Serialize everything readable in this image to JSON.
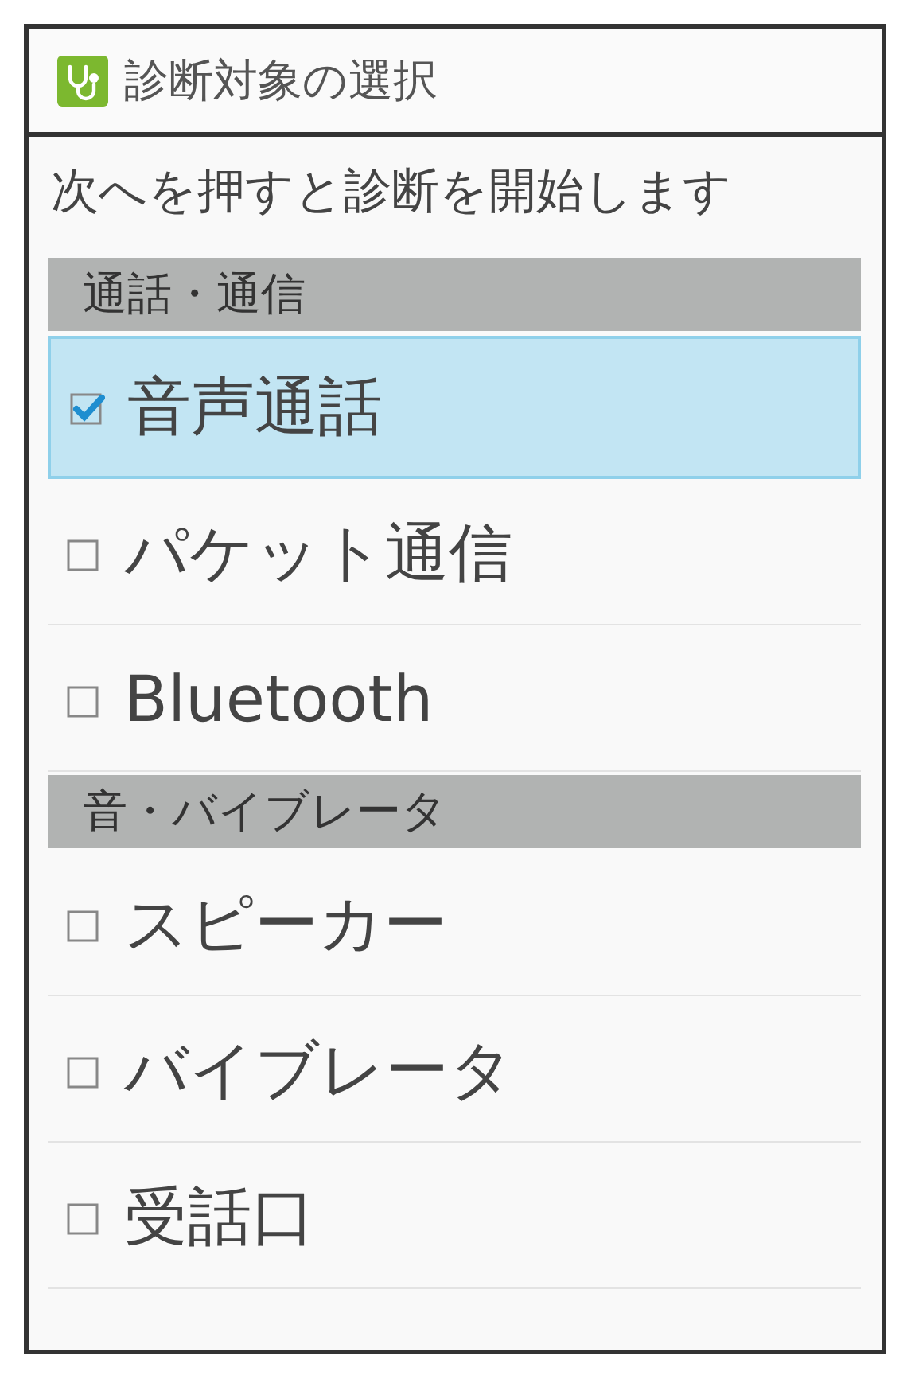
{
  "window": {
    "title": "診断対象の選択"
  },
  "instruction": "次へを押すと診断を開始します",
  "sections": [
    {
      "header": "通話・通信",
      "items": [
        {
          "label": "音声通話",
          "checked": true,
          "selected": true
        },
        {
          "label": "パケット通信",
          "checked": false,
          "selected": false
        },
        {
          "label": "Bluetooth",
          "checked": false,
          "selected": false
        }
      ]
    },
    {
      "header": "音・バイブレータ",
      "items": [
        {
          "label": "スピーカー",
          "checked": false,
          "selected": false
        },
        {
          "label": "バイブレータ",
          "checked": false,
          "selected": false
        },
        {
          "label": "受話口",
          "checked": false,
          "selected": false
        }
      ]
    }
  ]
}
